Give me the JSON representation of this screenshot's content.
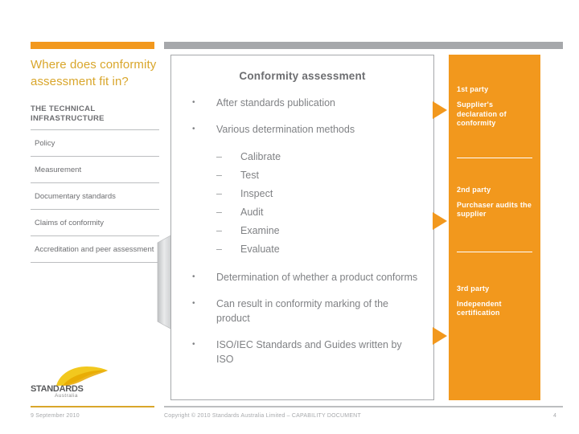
{
  "slide": {
    "accent_orange": "#F2981D",
    "accent_gold": "#D9A62B",
    "gray": "#A6A8AB",
    "text_gray": "#808285"
  },
  "sidebar": {
    "title": "Where does conformity assessment fit in?",
    "subheading": "THE TECHNICAL INFRASTRUCTURE",
    "items": [
      {
        "label": "Policy"
      },
      {
        "label": "Measurement"
      },
      {
        "label": "Documentary standards"
      },
      {
        "label": "Claims of conformity"
      },
      {
        "label": "Accreditation and peer assessment"
      }
    ],
    "logo": {
      "wordmark": "STANDARDS",
      "sub": "Australia",
      "swoosh_color": "#F5C518"
    }
  },
  "card": {
    "title": "Conformity assessment",
    "bullets": [
      {
        "marker": "•",
        "text": "After standards publication",
        "sub": []
      },
      {
        "marker": "•",
        "text": "Various determination methods",
        "sub": [
          {
            "marker": "–",
            "text": "Calibrate"
          },
          {
            "marker": "–",
            "text": "Test"
          },
          {
            "marker": "–",
            "text": "Inspect"
          },
          {
            "marker": "–",
            "text": "Audit"
          },
          {
            "marker": "–",
            "text": "Examine"
          },
          {
            "marker": "–",
            "text": "Evaluate"
          }
        ]
      },
      {
        "marker": "•",
        "text": "Determination of whether a product conforms",
        "sub": []
      },
      {
        "marker": "•",
        "text": "Can result in conformity marking of the product",
        "sub": []
      },
      {
        "marker": "•",
        "text": "ISO/IEC Standards and Guides written by ISO",
        "sub": []
      }
    ]
  },
  "parties": [
    {
      "kicker": "1st party",
      "body": "Supplier's declaration of conformity"
    },
    {
      "kicker": "2nd party",
      "body": "Purchaser audits the supplier"
    },
    {
      "kicker": "3rd party",
      "body": "Independent certification"
    }
  ],
  "footer": {
    "date": "9 September 2010",
    "copyright": "Copyright © 2010 Standards Australia Limited  –  CAPABILITY DOCUMENT",
    "page": "4"
  }
}
